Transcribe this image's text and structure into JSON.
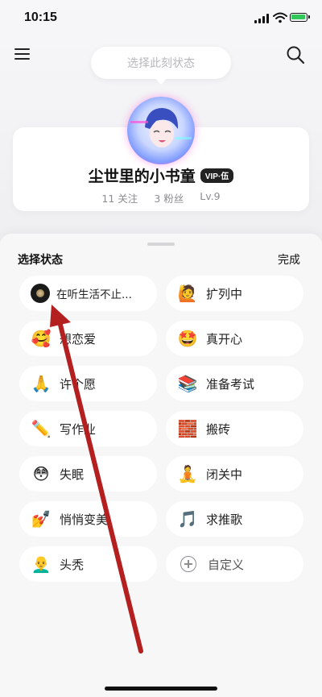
{
  "status_bar": {
    "time": "10:15"
  },
  "header": {
    "status_placeholder": "选择此刻状态"
  },
  "profile": {
    "name": "尘世里的小书童",
    "vip_badge": "VIP·伍",
    "stats": [
      "11 关注",
      "3 粉丝",
      "Lv.9"
    ]
  },
  "sheet": {
    "title": "选择状态",
    "done": "完成",
    "options": [
      {
        "icon": "vinyl-record-icon",
        "emoji": "",
        "label": "在听生活不止..."
      },
      {
        "icon": "person-raising-hand-icon",
        "emoji": "🙋",
        "label": "扩列中"
      },
      {
        "icon": "smiling-face-with-hearts-icon",
        "emoji": "🥰",
        "label": "想恋爱"
      },
      {
        "icon": "star-struck-icon",
        "emoji": "🤩",
        "label": "真开心"
      },
      {
        "icon": "folded-hands-icon",
        "emoji": "🙏",
        "label": "许个愿"
      },
      {
        "icon": "books-icon",
        "emoji": "📚",
        "label": "准备考试"
      },
      {
        "icon": "pencil-icon",
        "emoji": "✏️",
        "label": "写作业"
      },
      {
        "icon": "brick-icon",
        "emoji": "🧱",
        "label": "搬砖"
      },
      {
        "icon": "flushed-face-icon",
        "emoji": "😳",
        "label": "失眠"
      },
      {
        "icon": "person-meditating-icon",
        "emoji": "🧘",
        "label": "闭关中"
      },
      {
        "icon": "nail-polish-icon",
        "emoji": "💅",
        "label": "悄悄变美"
      },
      {
        "icon": "musical-notes-icon",
        "emoji": "🎵",
        "label": "求推歌"
      },
      {
        "icon": "bald-person-icon",
        "emoji": "👨‍🦲",
        "label": "头秃"
      },
      {
        "icon": "plus-circle-icon",
        "emoji": "",
        "label": "自定义"
      }
    ]
  },
  "colors": {
    "annotation_arrow": "#b41f1f",
    "vip_badge_bg": "#222222"
  }
}
